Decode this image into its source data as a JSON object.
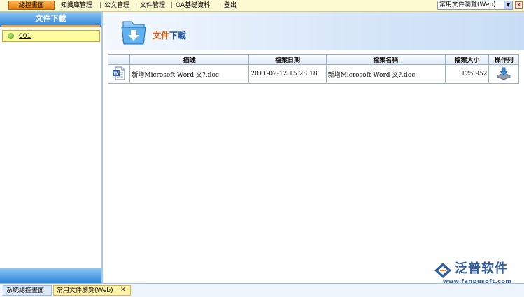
{
  "topbar": {
    "home_label": "總控畫面",
    "items": [
      "知識庫管理",
      "公文管理",
      "文件管理",
      "OA基礎資料"
    ],
    "logout_label": "登出",
    "select_value": "常用文件瀏覽(Web)",
    "select_arrow": "▼",
    "close_glyph": "✕"
  },
  "sidebar": {
    "title": "文件下載",
    "items": [
      {
        "label": "001"
      }
    ]
  },
  "main": {
    "title_part1": "文件",
    "title_part2": "下載",
    "table": {
      "headers": [
        "",
        "描述",
        "檔案日期",
        "檔案名稱",
        "檔案大小",
        "操作列"
      ],
      "rows": [
        {
          "description": "新增Microsoft Word 文?.doc",
          "date": "2011-02-12 15:28:18",
          "filename": "新增Microsoft Word 文?.doc",
          "size": "125,952"
        }
      ]
    }
  },
  "bottombar": {
    "tabs": [
      {
        "label": "系統總控畫面"
      },
      {
        "label": "常用文件瀏覽(Web)"
      }
    ],
    "close_glyph": "✕"
  },
  "logo": {
    "name": "泛普软件",
    "url": "www.fanpusoft.com"
  },
  "colors": {
    "accent_orange": "#e77b12",
    "panel_blue": "#2b86d8",
    "title_blue": "#1a4f9c"
  }
}
